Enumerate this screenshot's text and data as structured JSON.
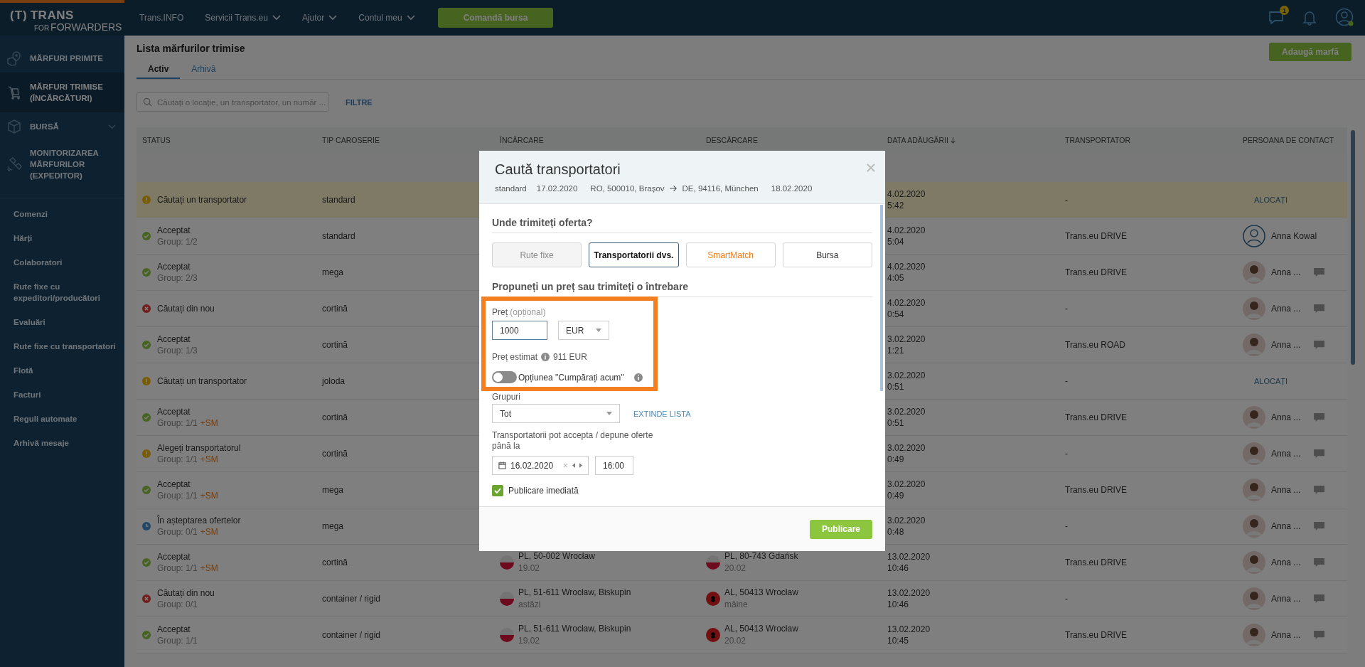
{
  "top_bar": {
    "logo": {
      "mark": "(T)",
      "name": "TRANS",
      "prefix": "FOR",
      "suffix": "FORWARDERS"
    },
    "nav": [
      {
        "label": "Trans.INFO",
        "dropdown": false
      },
      {
        "label": "Servicii Trans.eu",
        "dropdown": true
      },
      {
        "label": "Ajutor",
        "dropdown": true
      },
      {
        "label": "Contul meu",
        "dropdown": true
      }
    ],
    "order_button": "Comandă bursa",
    "messages_badge": "1"
  },
  "sidebar": {
    "main_items": [
      {
        "label": "MĂRFURI PRIMITE",
        "kind": "received",
        "selected": false,
        "expandable": false
      },
      {
        "label": "MĂRFURI TRIMISE (ÎNCĂRCĂTURI)",
        "kind": "sent",
        "selected": true,
        "expandable": false
      },
      {
        "label": "BURSĂ",
        "kind": "exchange",
        "selected": false,
        "expandable": true
      },
      {
        "label": "MONITORIZAREA MĂRFURILOR (EXPEDITOR)",
        "kind": "monitoring",
        "selected": false,
        "expandable": false
      }
    ],
    "links": [
      "Comenzi",
      "Hărți",
      "Colaboratori",
      "Rute fixe cu expeditori/producători",
      "Evaluări",
      "Rute fixe cu transportatori",
      "Flotă",
      "Facturi",
      "Reguli automate",
      "Arhivă mesaje"
    ]
  },
  "page": {
    "title": "Lista mărfurilor trimise",
    "tabs": [
      {
        "label": "Activ",
        "selected": true
      },
      {
        "label": "Arhivă",
        "selected": false
      }
    ],
    "add_button": "Adaugă marfă",
    "search": {
      "placeholder": "Căutați o locație, un transportator, un număr ..."
    },
    "filters_link": "FILTRE"
  },
  "table": {
    "columns": [
      {
        "label": "STATUS",
        "sorted": false
      },
      {
        "label": "TIP CAROSERIE",
        "sorted": false
      },
      {
        "label": "ÎNCĂRCARE",
        "sorted": false
      },
      {
        "label": "DESCĂRCARE",
        "sorted": false
      },
      {
        "label": "DATA ADĂUGĂRII",
        "sorted": true
      },
      {
        "label": "TRANSPORTATOR",
        "sorted": false
      },
      {
        "label": "PERSOANA DE CONTACT",
        "sorted": false
      }
    ],
    "rows": [
      {
        "kind": "warning",
        "status": "Căutați un transportator",
        "body_type": "standard",
        "date": "4.02.2020",
        "time": "5:42",
        "carrier": "-",
        "contact": {
          "kind": "assign",
          "label": "ALOCAȚI"
        },
        "highlighted": true
      },
      {
        "kind": "ok",
        "status": "Acceptat",
        "group": "Group: 1/2",
        "body_type": "standard",
        "date": "4.02.2020",
        "time": "5:04",
        "carrier": "Trans.eu DRIVE",
        "contact": {
          "kind": "user",
          "name": "Anna Kowal"
        },
        "highlighted": false
      },
      {
        "kind": "ok",
        "status": "Acceptat",
        "group": "Group: 2/3",
        "body_type": "mega",
        "date": "4.02.2020",
        "time": "4:05",
        "carrier": "Trans.eu DRIVE",
        "contact": {
          "kind": "avatar",
          "name": "Anna ..."
        },
        "highlighted": false
      },
      {
        "kind": "error",
        "status": "Căutați din nou",
        "body_type": "cortină",
        "date": "4.02.2020",
        "time": "0:54",
        "carrier": "-",
        "contact": {
          "kind": "avatar",
          "name": "Anna ..."
        },
        "highlighted": false
      },
      {
        "kind": "ok",
        "status": "Acceptat",
        "group": "Group: 1/3",
        "body_type": "cortină",
        "date": "3.02.2020",
        "time": "1:21",
        "carrier": "Trans.eu ROAD",
        "contact": {
          "kind": "avatar",
          "name": "Anna ..."
        },
        "highlighted": false
      },
      {
        "kind": "warning",
        "status": "Căutați un transportator",
        "body_type": "joloda",
        "date": "3.02.2020",
        "time": "0:51",
        "carrier": "-",
        "contact": {
          "kind": "assign",
          "label": "ALOCAȚI"
        },
        "highlighted": false
      },
      {
        "kind": "ok",
        "status": "Acceptat",
        "group": "Group: 1/1",
        "tag": "+SM",
        "body_type": "cortină",
        "date": "3.02.2020",
        "time": "0:51",
        "carrier": "Trans.eu DRIVE",
        "contact": {
          "kind": "avatar",
          "name": "Anna ..."
        },
        "highlighted": false
      },
      {
        "kind": "warning",
        "status": "Alegeți transportatorul",
        "group": "Group: 1/1",
        "tag": "+SM",
        "body_type": "cortină",
        "date": "3.02.2020",
        "time": "0:49",
        "carrier": "-",
        "contact": {
          "kind": "avatar",
          "name": "Anna ..."
        },
        "highlighted": false
      },
      {
        "kind": "ok",
        "status": "Acceptat",
        "group": "Group: 1/1",
        "tag": "+SM",
        "body_type": "mega",
        "date": "3.02.2020",
        "time": "0:49",
        "carrier": "Trans.eu DRIVE",
        "contact": {
          "kind": "avatar",
          "name": "Anna ..."
        },
        "highlighted": false
      },
      {
        "kind": "waiting",
        "status": "În așteptarea ofertelor",
        "group": "Group: 0/1",
        "tag": "+SM",
        "body_type": "mega",
        "date": "3.02.2020",
        "time": "0:48",
        "carrier": "-",
        "contact": {
          "kind": "avatar",
          "name": "Anna ..."
        },
        "highlighted": false
      },
      {
        "kind": "ok",
        "status": "Acceptat",
        "group": "Group: 1/1",
        "tag": "+SM",
        "body_type": "cortină",
        "loading": {
          "kind": "pl",
          "place": "PL, 50-002 Wrocław",
          "day": "19.02"
        },
        "unloading": {
          "kind": "pl",
          "place": "PL, 80-743 Gdańsk",
          "day": "20.02"
        },
        "date": "13.02.2020",
        "time": "10:46",
        "carrier": "Trans.eu DRIVE",
        "contact": {
          "kind": "avatar",
          "name": "Anna ..."
        },
        "highlighted": false
      },
      {
        "kind": "error",
        "status": "Căutați din nou",
        "group": "Group: 0/1",
        "body_type": "container / rigid",
        "loading": {
          "kind": "pl",
          "place": "PL, 51-611 Wrocław, Biskupin",
          "day": "astăzi"
        },
        "unloading": {
          "kind": "al",
          "place": "AL, 50413 Wrocław",
          "day": "mâine"
        },
        "date": "13.02.2020",
        "time": "10:46",
        "carrier": "-",
        "contact": {
          "kind": "avatar",
          "name": "Anna ..."
        },
        "highlighted": false
      },
      {
        "kind": "ok",
        "status": "Acceptat",
        "group": "Group: 1/1",
        "body_type": "container / rigid",
        "loading": {
          "kind": "pl",
          "place": "PL, 51-611 Wrocław, Biskupin",
          "day": "19.02"
        },
        "unloading": {
          "kind": "al",
          "place": "AL, 50413 Wrocław",
          "day": "20.02"
        },
        "date": "13.02.2020",
        "time": "10:45",
        "carrier": "Trans.eu DRIVE",
        "contact": {
          "kind": "avatar",
          "name": "Anna ..."
        },
        "highlighted": false
      }
    ]
  },
  "modal": {
    "title": "Caută transportatori",
    "summary": {
      "body_type": "standard",
      "load_date": "17.02.2020",
      "origin": "RO, 500010, Brașov",
      "destination": "DE, 94116, München",
      "unload_date": "18.02.2020"
    },
    "destination_section": {
      "title": "Unde trimiteți oferta?",
      "options": [
        {
          "label": "Rute fixe",
          "kind": "plain",
          "selected": false,
          "disabled": true
        },
        {
          "label": "Transportatorii dvs.",
          "kind": "plain",
          "selected": true,
          "disabled": false
        },
        {
          "label": "SmartMatch",
          "kind": "smart",
          "selected": false,
          "disabled": false
        },
        {
          "label": "Bursa",
          "kind": "plain",
          "selected": false,
          "disabled": false
        }
      ]
    },
    "price_section": {
      "title": "Propuneți un preț sau trimiteți o întrebare",
      "highlighted": true,
      "price_label": "Preț",
      "price_hint": "(opțional)",
      "price_value": "1000",
      "currency": "EUR",
      "estimate_label": "Preț estimat",
      "estimate_value": "911 EUR",
      "buy_now": {
        "label": "Opțiunea \"Cumpărați acum\"",
        "on": false
      }
    },
    "groups": {
      "label": "Grupuri",
      "value": "Tot",
      "expand_link": "EXTINDE LISTA"
    },
    "deadline": {
      "label": "Transportatorii pot accepta / depune oferte până la",
      "date": "16.02.2020",
      "time": "16:00"
    },
    "publish_now": {
      "label": "Publicare imediată",
      "checked": true
    },
    "submit": "Publicare"
  }
}
